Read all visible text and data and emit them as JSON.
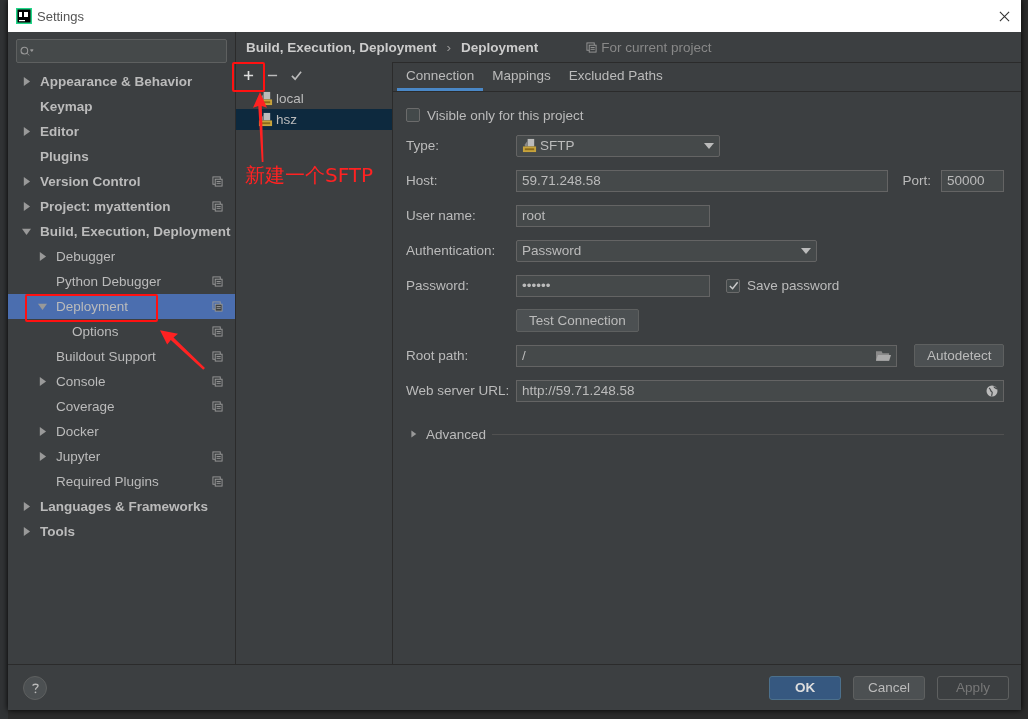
{
  "window": {
    "title": "Settings"
  },
  "sidebar": {
    "items": [
      {
        "label": "Appearance & Behavior",
        "expanded": false,
        "selected": false
      },
      {
        "label": "Keymap",
        "selected": false
      },
      {
        "label": "Editor",
        "expanded": false,
        "selected": false
      },
      {
        "label": "Plugins",
        "selected": false
      },
      {
        "label": "Version Control",
        "expanded": false,
        "project_scope": true,
        "selected": false
      },
      {
        "label": "Project: myattention",
        "expanded": false,
        "project_scope": true,
        "selected": false
      },
      {
        "label": "Build, Execution, Deployment",
        "expanded": true,
        "selected": false,
        "children": [
          {
            "label": "Debugger",
            "expanded": false,
            "selected": false
          },
          {
            "label": "Python Debugger",
            "project_scope": true,
            "selected": false
          },
          {
            "label": "Deployment",
            "expanded": true,
            "project_scope": true,
            "selected": true,
            "children": [
              {
                "label": "Options",
                "project_scope": true,
                "selected": false
              }
            ]
          },
          {
            "label": "Buildout Support",
            "project_scope": true,
            "selected": false
          },
          {
            "label": "Console",
            "expanded": false,
            "project_scope": true,
            "selected": false
          },
          {
            "label": "Coverage",
            "project_scope": true,
            "selected": false
          },
          {
            "label": "Docker",
            "expanded": false,
            "selected": false
          },
          {
            "label": "Jupyter",
            "expanded": false,
            "project_scope": true,
            "selected": false
          },
          {
            "label": "Required Plugins",
            "project_scope": true,
            "selected": false
          }
        ]
      },
      {
        "label": "Languages & Frameworks",
        "expanded": false,
        "selected": false
      },
      {
        "label": "Tools",
        "expanded": false,
        "selected": false
      }
    ]
  },
  "breadcrumb": {
    "parts": [
      "Build, Execution, Deployment",
      "Deployment"
    ],
    "separator": "›",
    "scope": "For current project"
  },
  "servers": [
    {
      "name": "local",
      "selected": false
    },
    {
      "name": "hsz",
      "selected": true
    }
  ],
  "tabs": [
    {
      "label": "Connection",
      "selected": true
    },
    {
      "label": "Mappings",
      "selected": false
    },
    {
      "label": "Excluded Paths",
      "selected": false
    }
  ],
  "form": [
    {
      "kind": "checkbox",
      "label": "Visible only for this project",
      "checked": false
    },
    {
      "kind": "type_dropdown",
      "label": "Type:",
      "value": "SFTP"
    },
    {
      "kind": "host",
      "label": "Host:",
      "value": "59.71.248.58",
      "port_label": "Port:",
      "port": "50000"
    },
    {
      "kind": "text",
      "label": "User name:",
      "value": "root"
    },
    {
      "kind": "dropdown",
      "label": "Authentication:",
      "value": "Password"
    },
    {
      "kind": "password",
      "label": "Password:",
      "value": "••••••",
      "save_label": "Save password",
      "save_checked": true
    },
    {
      "kind": "button",
      "label": "Test Connection"
    },
    {
      "kind": "path",
      "label": "Root path:",
      "value": "/",
      "button": "Autodetect"
    },
    {
      "kind": "url",
      "label": "Web server URL:",
      "value": "http://59.71.248.58"
    },
    {
      "kind": "section",
      "label": "Advanced",
      "expanded": false
    }
  ],
  "buttons": [
    {
      "label": "OK",
      "kind": "default",
      "disabled": false
    },
    {
      "label": "Cancel",
      "kind": "normal",
      "disabled": false
    },
    {
      "label": "Apply",
      "kind": "normal",
      "disabled": true
    }
  ],
  "annotation": {
    "text": "新建一个SFTP"
  }
}
